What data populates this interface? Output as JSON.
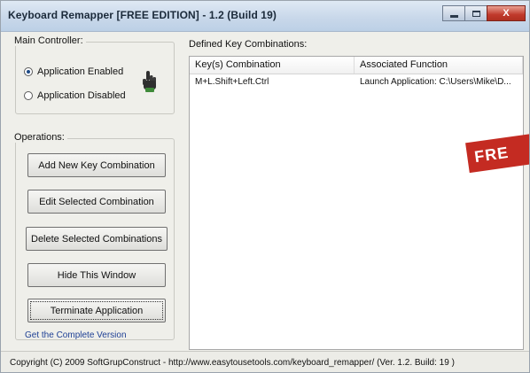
{
  "window": {
    "title": "Keyboard Remapper [FREE EDITION] - 1.2 (Build 19)",
    "close_glyph": "X"
  },
  "main_controller": {
    "label": "Main Controller:",
    "options": [
      {
        "label": "Application Enabled",
        "selected": true
      },
      {
        "label": "Application Disabled",
        "selected": false
      }
    ],
    "icon": "hand-pointer-icon"
  },
  "operations": {
    "label": "Operations:",
    "buttons": [
      "Add New Key Combination",
      "Edit Selected Combination",
      "Delete Selected Combinations",
      "Hide This Window",
      "Terminate Application"
    ],
    "link": "Get the Complete Version"
  },
  "combinations": {
    "label": "Defined Key Combinations:",
    "columns": [
      "Key(s) Combination",
      "Associated Function"
    ],
    "rows": [
      [
        "M+L.Shift+Left.Ctrl",
        "Launch Application: C:\\Users\\Mike\\D..."
      ]
    ]
  },
  "banner": {
    "text": "FRE"
  },
  "status": {
    "text": "Copyright (C) 2009 SoftGrupConstruct - http://www.easytousetools.com/keyboard_remapper/ (Ver. 1.2. Build: 19 )"
  },
  "colors": {
    "link": "#1d3f94",
    "banner": "#c42b22",
    "titlebar": "#c9d8ea"
  }
}
